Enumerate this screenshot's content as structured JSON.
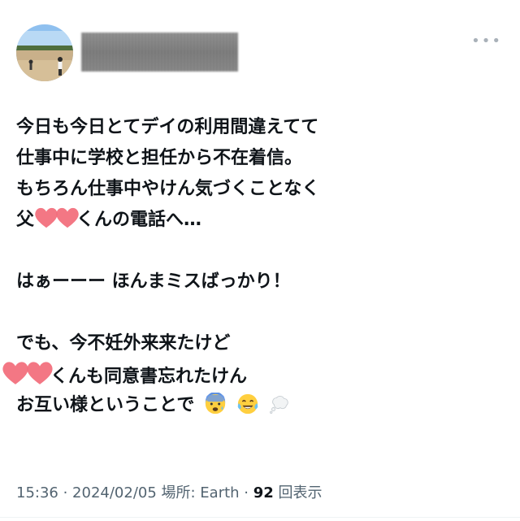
{
  "more_label": "•••",
  "lines": [
    "今日も今日とてデイの利用間違えてて",
    "仕事中に学校と担任から不在着信。",
    "もちろん仕事中やけん気づくことなく",
    "くんの電話へ…",
    "",
    "はぁーーー ほんまミスばっかり！",
    "",
    "でも、今不妊外来来たけど",
    "くんも同意書忘れたけん",
    "お互い様ということで"
  ],
  "line4_prefix": "父",
  "emojis": [
    "anxious-face-icon",
    "tears-of-joy-icon",
    "thought-bubble-icon"
  ],
  "meta": {
    "time": "15:36",
    "sep1": " · ",
    "date": "2024/02/05",
    "location": " 場所: Earth",
    "sep2": " · ",
    "views": "92",
    "views_label": " 回表示"
  },
  "colors": {
    "heart": "#f26b7a",
    "meta": "#536471",
    "text": "#0f1419"
  }
}
